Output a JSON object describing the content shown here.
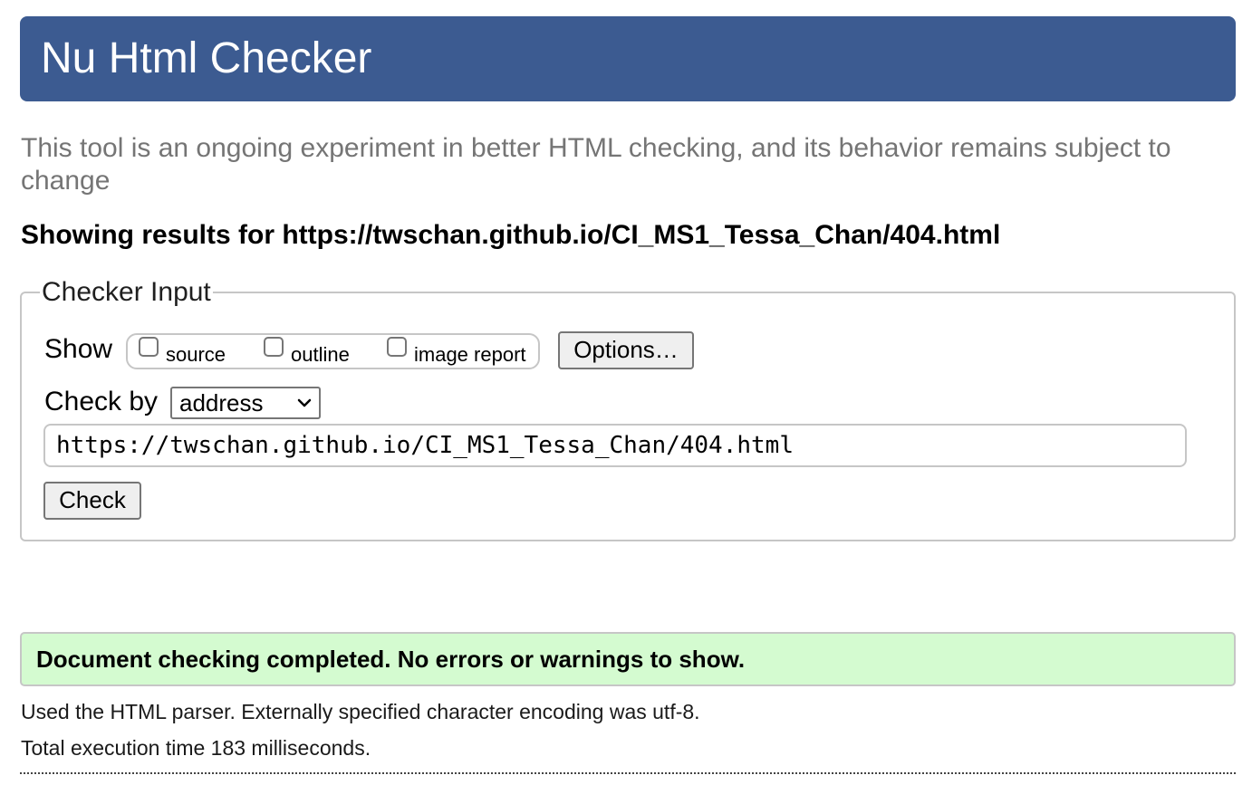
{
  "header": {
    "title": "Nu Html Checker"
  },
  "intro": "This tool is an ongoing experiment in better HTML checking, and its behavior remains subject to change",
  "results_heading": "Showing results for https://twschan.github.io/CI_MS1_Tessa_Chan/404.html",
  "checker_input": {
    "legend": "Checker Input",
    "show_label": "Show",
    "checkboxes": [
      {
        "label": "source",
        "checked": false
      },
      {
        "label": "outline",
        "checked": false
      },
      {
        "label": "image report",
        "checked": false
      }
    ],
    "options_button": "Options…",
    "check_by_label": "Check by",
    "check_by_value": "address",
    "url_value": "https://twschan.github.io/CI_MS1_Tessa_Chan/404.html",
    "check_button": "Check"
  },
  "result": {
    "success_message": "Document checking completed. No errors or warnings to show.",
    "parser_note": "Used the HTML parser. Externally specified character encoding was utf-8.",
    "execution_time": "Total execution time 183 milliseconds."
  },
  "colors": {
    "header_bg": "#3c5b91",
    "success_bg": "#d4fbd0",
    "intro_text": "#757575"
  }
}
